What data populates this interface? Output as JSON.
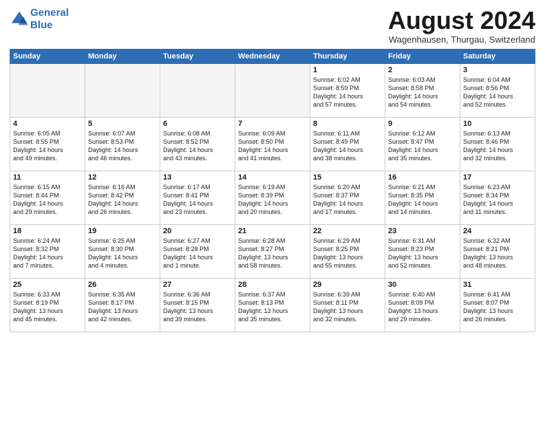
{
  "header": {
    "logo_line1": "General",
    "logo_line2": "Blue",
    "month_title": "August 2024",
    "location": "Wagenhausen, Thurgau, Switzerland"
  },
  "days_of_week": [
    "Sunday",
    "Monday",
    "Tuesday",
    "Wednesday",
    "Thursday",
    "Friday",
    "Saturday"
  ],
  "weeks": [
    [
      {
        "day": "",
        "text": ""
      },
      {
        "day": "",
        "text": ""
      },
      {
        "day": "",
        "text": ""
      },
      {
        "day": "",
        "text": ""
      },
      {
        "day": "1",
        "text": "Sunrise: 6:02 AM\nSunset: 8:59 PM\nDaylight: 14 hours\nand 57 minutes."
      },
      {
        "day": "2",
        "text": "Sunrise: 6:03 AM\nSunset: 8:58 PM\nDaylight: 14 hours\nand 54 minutes."
      },
      {
        "day": "3",
        "text": "Sunrise: 6:04 AM\nSunset: 8:56 PM\nDaylight: 14 hours\nand 52 minutes."
      }
    ],
    [
      {
        "day": "4",
        "text": "Sunrise: 6:05 AM\nSunset: 8:55 PM\nDaylight: 14 hours\nand 49 minutes."
      },
      {
        "day": "5",
        "text": "Sunrise: 6:07 AM\nSunset: 8:53 PM\nDaylight: 14 hours\nand 46 minutes."
      },
      {
        "day": "6",
        "text": "Sunrise: 6:08 AM\nSunset: 8:52 PM\nDaylight: 14 hours\nand 43 minutes."
      },
      {
        "day": "7",
        "text": "Sunrise: 6:09 AM\nSunset: 8:50 PM\nDaylight: 14 hours\nand 41 minutes."
      },
      {
        "day": "8",
        "text": "Sunrise: 6:11 AM\nSunset: 8:49 PM\nDaylight: 14 hours\nand 38 minutes."
      },
      {
        "day": "9",
        "text": "Sunrise: 6:12 AM\nSunset: 8:47 PM\nDaylight: 14 hours\nand 35 minutes."
      },
      {
        "day": "10",
        "text": "Sunrise: 6:13 AM\nSunset: 8:46 PM\nDaylight: 14 hours\nand 32 minutes."
      }
    ],
    [
      {
        "day": "11",
        "text": "Sunrise: 6:15 AM\nSunset: 8:44 PM\nDaylight: 14 hours\nand 29 minutes."
      },
      {
        "day": "12",
        "text": "Sunrise: 6:16 AM\nSunset: 8:42 PM\nDaylight: 14 hours\nand 26 minutes."
      },
      {
        "day": "13",
        "text": "Sunrise: 6:17 AM\nSunset: 8:41 PM\nDaylight: 14 hours\nand 23 minutes."
      },
      {
        "day": "14",
        "text": "Sunrise: 6:19 AM\nSunset: 8:39 PM\nDaylight: 14 hours\nand 20 minutes."
      },
      {
        "day": "15",
        "text": "Sunrise: 6:20 AM\nSunset: 8:37 PM\nDaylight: 14 hours\nand 17 minutes."
      },
      {
        "day": "16",
        "text": "Sunrise: 6:21 AM\nSunset: 8:35 PM\nDaylight: 14 hours\nand 14 minutes."
      },
      {
        "day": "17",
        "text": "Sunrise: 6:23 AM\nSunset: 8:34 PM\nDaylight: 14 hours\nand 11 minutes."
      }
    ],
    [
      {
        "day": "18",
        "text": "Sunrise: 6:24 AM\nSunset: 8:32 PM\nDaylight: 14 hours\nand 7 minutes."
      },
      {
        "day": "19",
        "text": "Sunrise: 6:25 AM\nSunset: 8:30 PM\nDaylight: 14 hours\nand 4 minutes."
      },
      {
        "day": "20",
        "text": "Sunrise: 6:27 AM\nSunset: 8:28 PM\nDaylight: 14 hours\nand 1 minute."
      },
      {
        "day": "21",
        "text": "Sunrise: 6:28 AM\nSunset: 8:27 PM\nDaylight: 13 hours\nand 58 minutes."
      },
      {
        "day": "22",
        "text": "Sunrise: 6:29 AM\nSunset: 8:25 PM\nDaylight: 13 hours\nand 55 minutes."
      },
      {
        "day": "23",
        "text": "Sunrise: 6:31 AM\nSunset: 8:23 PM\nDaylight: 13 hours\nand 52 minutes."
      },
      {
        "day": "24",
        "text": "Sunrise: 6:32 AM\nSunset: 8:21 PM\nDaylight: 13 hours\nand 48 minutes."
      }
    ],
    [
      {
        "day": "25",
        "text": "Sunrise: 6:33 AM\nSunset: 8:19 PM\nDaylight: 13 hours\nand 45 minutes."
      },
      {
        "day": "26",
        "text": "Sunrise: 6:35 AM\nSunset: 8:17 PM\nDaylight: 13 hours\nand 42 minutes."
      },
      {
        "day": "27",
        "text": "Sunrise: 6:36 AM\nSunset: 8:15 PM\nDaylight: 13 hours\nand 39 minutes."
      },
      {
        "day": "28",
        "text": "Sunrise: 6:37 AM\nSunset: 8:13 PM\nDaylight: 13 hours\nand 35 minutes."
      },
      {
        "day": "29",
        "text": "Sunrise: 6:39 AM\nSunset: 8:11 PM\nDaylight: 13 hours\nand 32 minutes."
      },
      {
        "day": "30",
        "text": "Sunrise: 6:40 AM\nSunset: 8:09 PM\nDaylight: 13 hours\nand 29 minutes."
      },
      {
        "day": "31",
        "text": "Sunrise: 6:41 AM\nSunset: 8:07 PM\nDaylight: 13 hours\nand 26 minutes."
      }
    ]
  ]
}
